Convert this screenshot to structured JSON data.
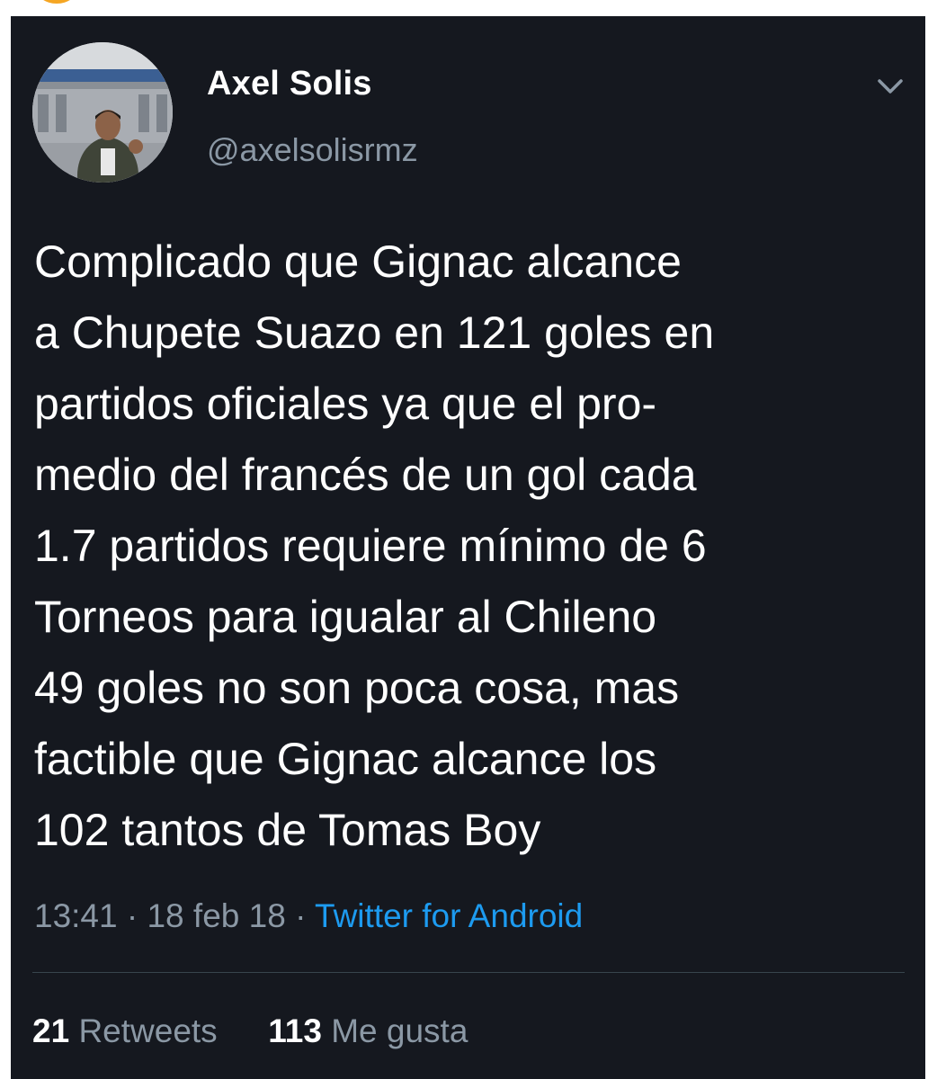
{
  "tweet": {
    "author": {
      "display_name": "Axel Solis",
      "handle": "@axelsolisrmz"
    },
    "text": "Complicado que Gignac alcance\na Chupete Suazo en 121 goles en\npartidos oficiales ya que el pro-\nmedio del francés de un gol cada\n1.7 partidos requiere mínimo de 6\nTorneos para igualar al Chileno\n49 goles no son poca cosa, mas\nfactible que Gignac alcance los\n102 tantos de Tomas Boy",
    "time": "13:41",
    "date": "18 feb 18",
    "separator": "·",
    "source": "Twitter for Android",
    "stats": {
      "retweets_count": "21",
      "retweets_label": "Retweets",
      "likes_count": "113",
      "likes_label": "Me gusta"
    }
  },
  "icons": {
    "menu": "chevron-down-icon"
  },
  "colors": {
    "background": "#15181f",
    "text_primary": "#ffffff",
    "text_secondary": "#8b98a5",
    "link": "#1d9bf0",
    "divider": "#38444d"
  }
}
